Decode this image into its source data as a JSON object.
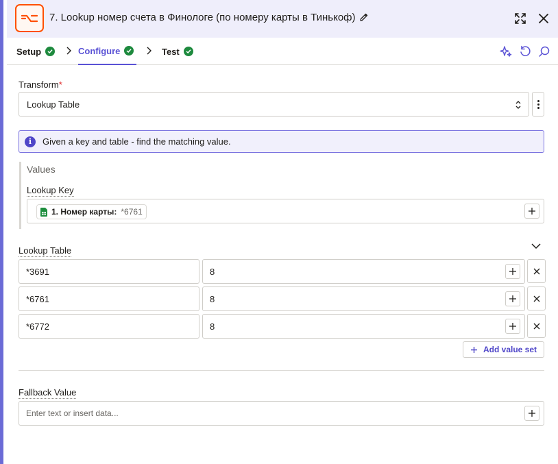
{
  "header": {
    "title": "7. Lookup номер счета в Финологе (по номеру карты в Тинькоф)"
  },
  "tabs": [
    {
      "label": "Setup",
      "active": false
    },
    {
      "label": "Configure",
      "active": true
    },
    {
      "label": "Test",
      "active": false
    }
  ],
  "transform": {
    "label": "Transform",
    "required_mark": "*",
    "selected": "Lookup Table"
  },
  "info": {
    "text": "Given a key and table - find the matching value."
  },
  "values": {
    "title": "Values",
    "lookup_key": {
      "label": "Lookup Key",
      "chip_label": "1. Номер карты:",
      "chip_value": "*6761"
    }
  },
  "lookup_table": {
    "label": "Lookup Table",
    "rows": [
      {
        "key": "*3691",
        "value": "8"
      },
      {
        "key": "*6761",
        "value": "8"
      },
      {
        "key": "*6772",
        "value": "8"
      }
    ],
    "add_label": "Add value set"
  },
  "fallback": {
    "label": "Fallback Value",
    "placeholder": "Enter text or insert data..."
  },
  "colors": {
    "accent": "#5a52d5",
    "success": "#1e8a3e",
    "brand": "#ff4f00",
    "info_bg": "#f1f0fc"
  }
}
